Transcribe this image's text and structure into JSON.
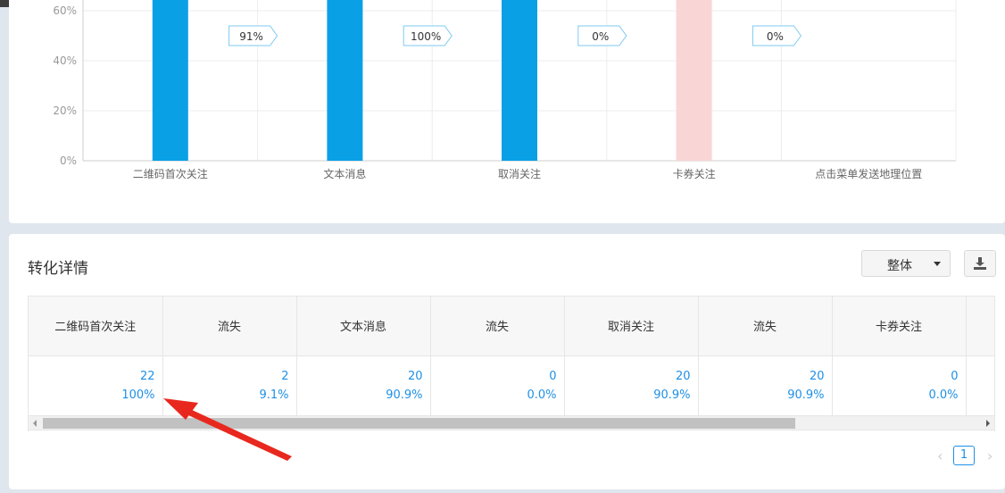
{
  "chart_data": {
    "type": "bar",
    "categories": [
      "二维码首次关注",
      "文本消息",
      "取消关注",
      "卡券关注",
      "点击菜单发送地理位置"
    ],
    "y_ticks": [
      "0%",
      "20%",
      "40%",
      "60%"
    ],
    "bar_colors": [
      "#0aa0e6",
      "#0aa0e6",
      "#0aa0e6",
      "#f9d5d6",
      null
    ],
    "rate_labels": [
      "91%",
      "100%",
      "0%",
      "0%"
    ],
    "grid": true
  },
  "conversion": {
    "title": "转化详情",
    "scope_select": "整体",
    "download_icon": "download-icon",
    "columns": [
      "二维码首次关注",
      "流失",
      "文本消息",
      "流失",
      "取消关注",
      "流失",
      "卡券关注",
      ""
    ],
    "values": [
      "22",
      "2",
      "20",
      "0",
      "20",
      "20",
      "0",
      ""
    ],
    "percents": [
      "100%",
      "9.1%",
      "90.9%",
      "0.0%",
      "90.9%",
      "90.9%",
      "0.0%",
      ""
    ],
    "page": "1"
  },
  "colors": {
    "accent": "#1e90e6",
    "bar": "#0aa0e6",
    "bar_light": "#f9d5d6",
    "annotation": "#e8281e"
  }
}
